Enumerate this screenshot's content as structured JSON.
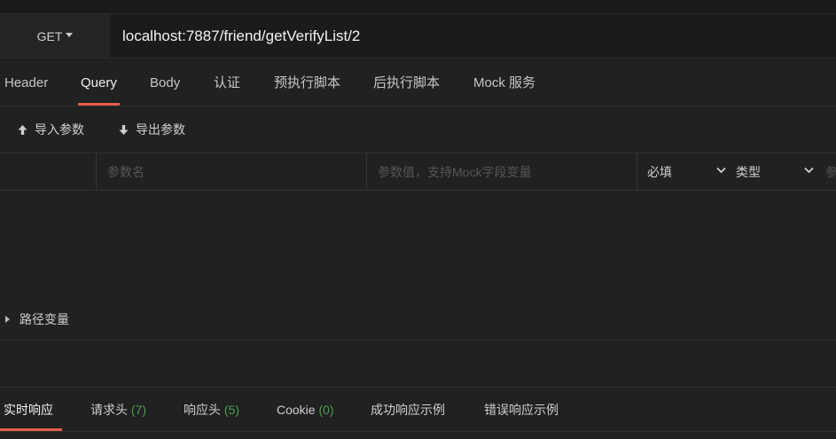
{
  "request": {
    "method": "GET",
    "url": "localhost:7887/friend/getVerifyList/2"
  },
  "tabs": {
    "header": "Header",
    "query": "Query",
    "body": "Body",
    "auth": "认证",
    "pre_script": "预执行脚本",
    "post_script": "后执行脚本",
    "mock": "Mock 服务"
  },
  "toolbar": {
    "import_label": "导入参数",
    "export_label": "导出参数"
  },
  "params": {
    "name_placeholder": "参数名",
    "value_placeholder": "参数值，支持Mock字段变量",
    "required_label": "必填",
    "type_label": "类型",
    "extra_label": "参"
  },
  "path_vars": {
    "label": "路径变量"
  },
  "response_tabs": {
    "realtime": "实时响应",
    "req_headers": "请求头",
    "req_headers_count": "(7)",
    "res_headers": "响应头",
    "res_headers_count": "(5)",
    "cookie": "Cookie",
    "cookie_count": "(0)",
    "success_example": "成功响应示例",
    "error_example": "错误响应示例"
  },
  "colors": {
    "accent": "#e55b4a",
    "count_green": "#4f9a4f",
    "background": "#212121"
  }
}
